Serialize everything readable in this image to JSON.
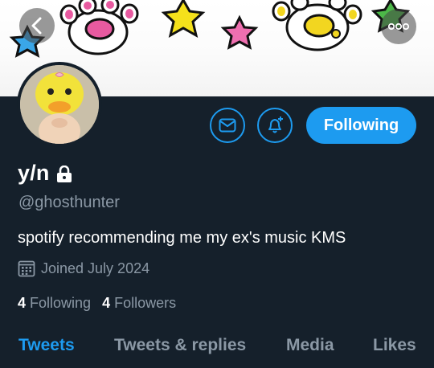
{
  "profile": {
    "name": "y/n",
    "handle": "@ghosthunter",
    "bio": "spotify recommending me my ex's music KMS",
    "joined": "Joined July 2024",
    "following_count": "4",
    "following_label": "Following",
    "followers_count": "4",
    "followers_label": "Followers"
  },
  "actions": {
    "follow_button_label": "Following"
  },
  "tabs": [
    {
      "label": "Tweets",
      "active": true
    },
    {
      "label": "Tweets & replies",
      "active": false
    },
    {
      "label": "Media",
      "active": false
    },
    {
      "label": "Likes",
      "active": false
    }
  ],
  "icons": {
    "back": "chevron-left-icon",
    "more": "more-dots-icon",
    "message": "envelope-icon",
    "notifications": "bell-plus-icon",
    "lock": "lock-icon",
    "calendar": "calendar-icon"
  },
  "colors": {
    "background": "#15202b",
    "accent": "#1d9bf0",
    "secondary_text": "#8b98a5",
    "primary_text": "#ffffff"
  }
}
